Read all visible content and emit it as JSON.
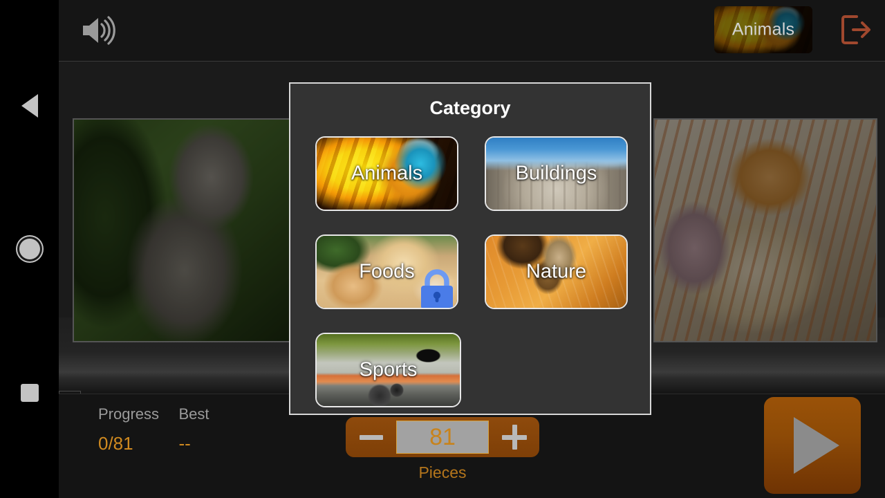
{
  "system_nav": {
    "back": "back-triangle",
    "home": "home-circle",
    "recent": "recent-square"
  },
  "topbar": {
    "sound_icon": "speaker-on-icon",
    "current_category": "Animals",
    "exit_icon": "exit-arrow-icon"
  },
  "modal": {
    "title": "Category",
    "categories": [
      {
        "label": "Animals",
        "image": "parrot",
        "locked": false
      },
      {
        "label": "Buildings",
        "image": "arch",
        "locked": false
      },
      {
        "label": "Foods",
        "image": "cookies",
        "locked": true
      },
      {
        "label": "Nature",
        "image": "acorn",
        "locked": false
      },
      {
        "label": "Sports",
        "image": "car",
        "locked": false
      }
    ],
    "lock_icon": "lock-icon"
  },
  "bottombar": {
    "progress_label": "Progress",
    "progress_value": "0/81",
    "best_label": "Best",
    "best_value": "--",
    "pieces_caption": "Pieces",
    "pieces_value": "81",
    "minus_label": "−",
    "plus_label": "+",
    "play_icon": "play-triangle-icon"
  },
  "colors": {
    "accent_orange": "#c8831c",
    "button_brown": "#8c470a",
    "exit_red": "#a0482e",
    "modal_bg": "#333333",
    "lock_blue": "#4a7ce8"
  }
}
